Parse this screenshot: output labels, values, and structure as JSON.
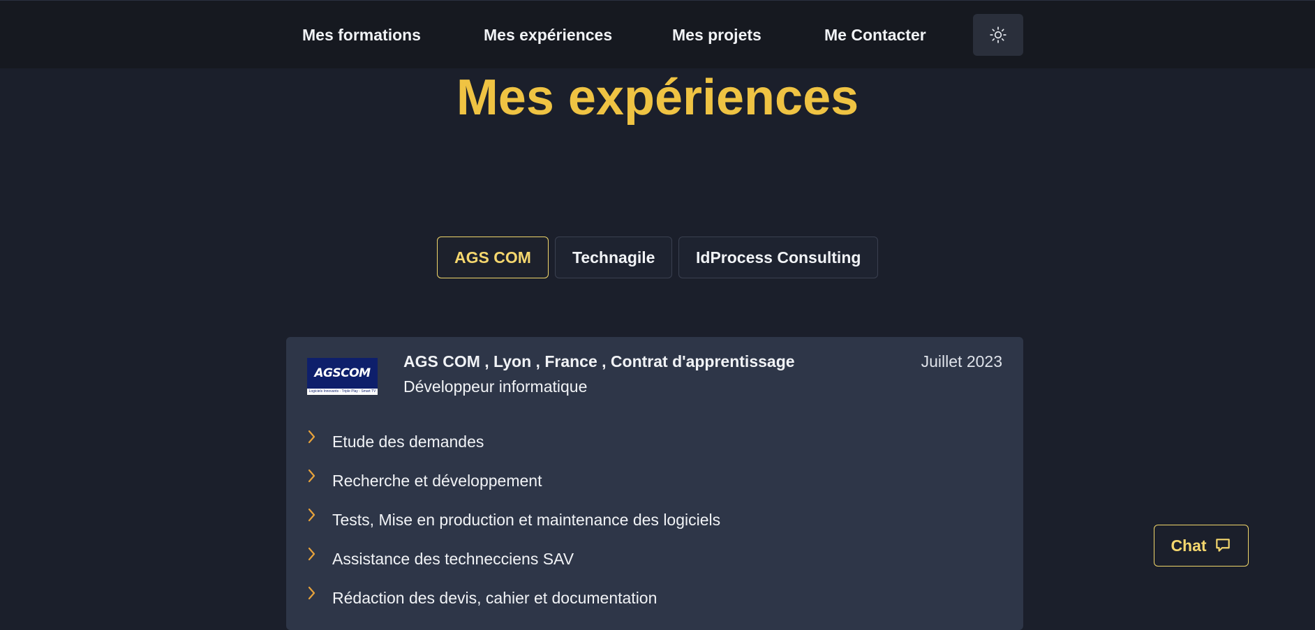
{
  "nav": {
    "links": [
      "Mes formations",
      "Mes expériences",
      "Mes projets",
      "Me Contacter"
    ],
    "theme_icon": "sun-icon"
  },
  "page": {
    "title": "Mes expériences"
  },
  "tabs": [
    {
      "label": "AGS COM",
      "active": true
    },
    {
      "label": "Technagile",
      "active": false
    },
    {
      "label": "IdProcess Consulting",
      "active": false
    }
  ],
  "experience": {
    "logo_text": "AGSCOM",
    "logo_tagline": "Logiciels Innovants - Triple Play - Smart TV",
    "title": "AGS COM , Lyon , France , Contrat d'apprentissage",
    "role": "Développeur informatique",
    "date": "Juillet 2023",
    "tasks": [
      "Etude des demandes",
      "Recherche et développement",
      "Tests, Mise en production et maintenance des logiciels",
      "Assistance des technecciens SAV",
      "Rédaction des devis, cahier et documentation"
    ]
  },
  "chat": {
    "label": "Chat",
    "icon": "chat-bubble-icon"
  },
  "colors": {
    "accent": "#efc343",
    "background": "#1b1f2b",
    "card": "#2e3648",
    "navbar": "#161920"
  }
}
